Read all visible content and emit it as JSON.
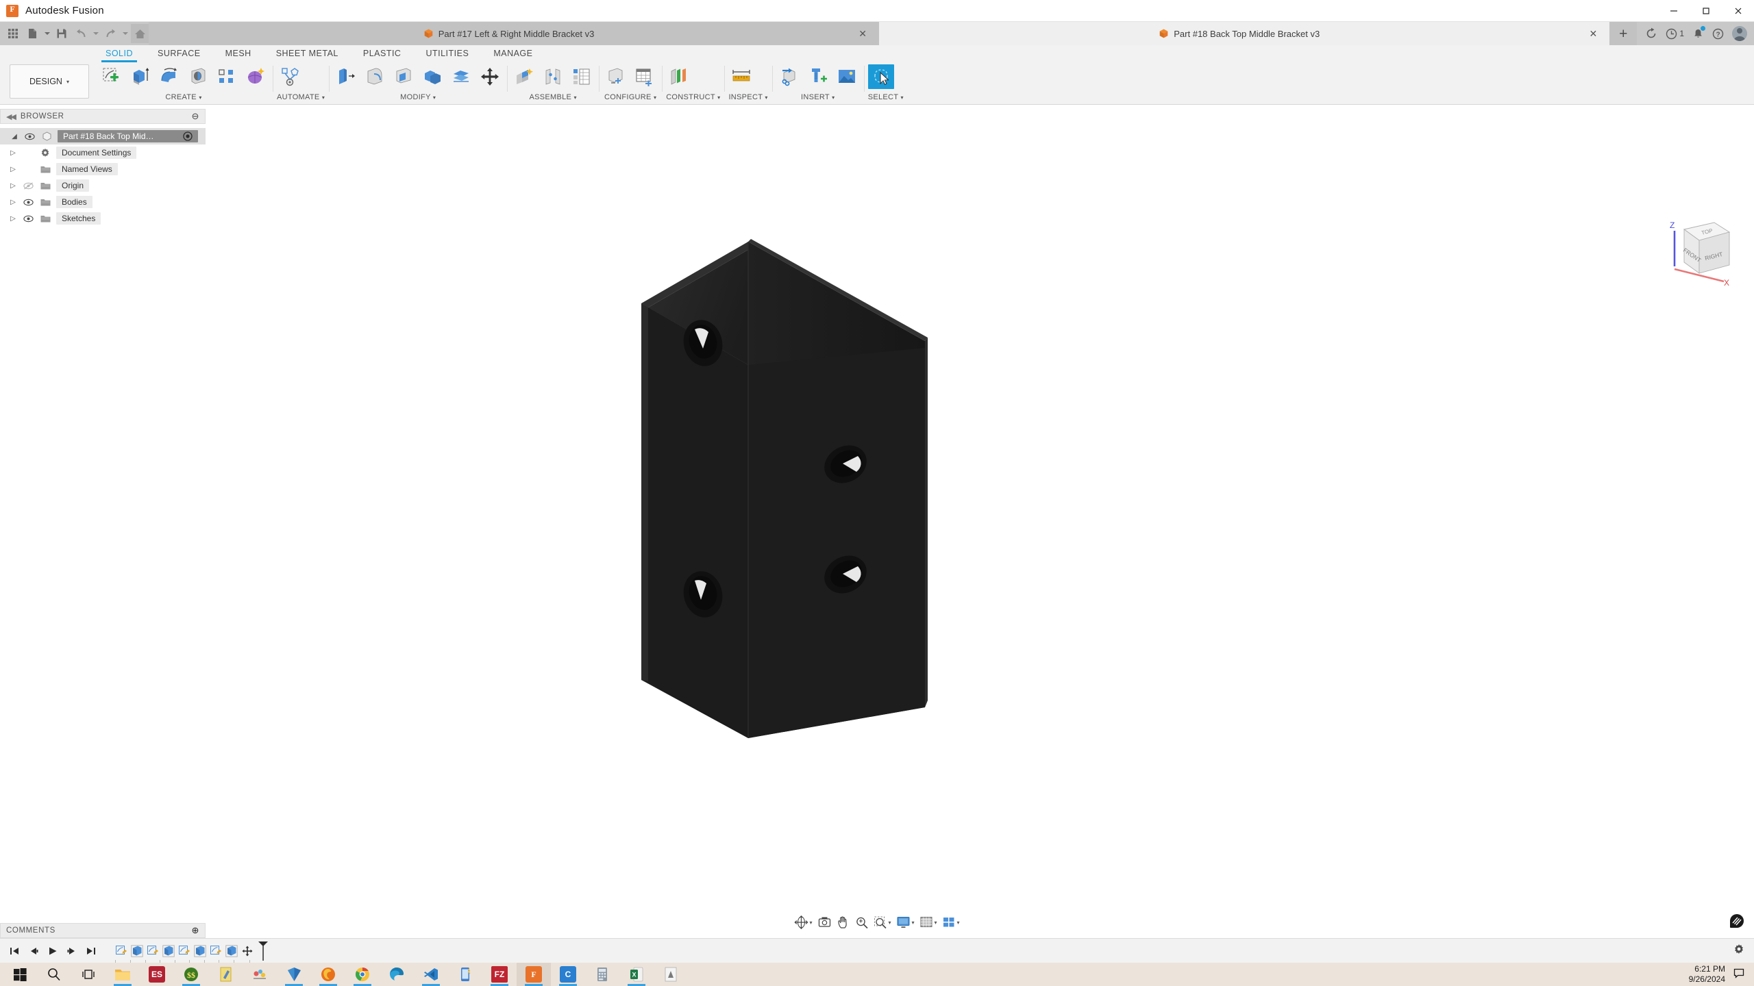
{
  "window": {
    "title": "Autodesk Fusion",
    "logo_icon": "fusion-logo-icon",
    "minimize_label": "—",
    "maximize_label": "□",
    "close_label": "✕"
  },
  "quick_access": {
    "items": [
      {
        "name": "app-grid-icon",
        "label": "App Grid"
      },
      {
        "name": "new-file-icon",
        "label": "New"
      },
      {
        "name": "save-icon",
        "label": "Save"
      },
      {
        "name": "undo-icon",
        "label": "Undo"
      },
      {
        "name": "redo-icon",
        "label": "Redo"
      },
      {
        "name": "home-icon",
        "label": "Home"
      }
    ]
  },
  "document_tabs": [
    {
      "title": "Part #17 Left & Right Middle Bracket v3",
      "active": false,
      "close_label": "✕"
    },
    {
      "title": "Part #18 Back Top Middle Bracket v3",
      "active": true,
      "close_label": "✕"
    }
  ],
  "new_tab_label": "+",
  "account_bar": {
    "sync_icon": "refresh-icon",
    "jobs_icon": "job-status-clock-icon",
    "jobs_count": "1",
    "notifications_icon": "bell-icon",
    "help_icon": "help-icon",
    "avatar_icon": "user-avatar"
  },
  "ribbon": {
    "workspace": "DESIGN",
    "workspace_caret": "▾",
    "tabs": [
      {
        "label": "SOLID",
        "active": true
      },
      {
        "label": "SURFACE",
        "active": false
      },
      {
        "label": "MESH",
        "active": false
      },
      {
        "label": "SHEET METAL",
        "active": false
      },
      {
        "label": "PLASTIC",
        "active": false
      },
      {
        "label": "UTILITIES",
        "active": false
      },
      {
        "label": "MANAGE",
        "active": false
      }
    ],
    "panels": [
      {
        "label": "CREATE",
        "caret": "▾",
        "tools": [
          {
            "name": "create-sketch-icon",
            "label": "Create Sketch"
          },
          {
            "name": "extrude-icon",
            "label": "Extrude"
          },
          {
            "name": "revolve-icon",
            "label": "Revolve"
          },
          {
            "name": "hole-icon",
            "label": "Hole"
          },
          {
            "name": "pattern-icon",
            "label": "Rectangular Pattern"
          },
          {
            "name": "create-form-icon",
            "label": "Create Form"
          }
        ]
      },
      {
        "label": "AUTOMATE",
        "caret": "▾",
        "tools": [
          {
            "name": "automated-modeling-icon",
            "label": "Automated Modeling"
          }
        ]
      },
      {
        "label": "MODIFY",
        "caret": "▾",
        "tools": [
          {
            "name": "press-pull-icon",
            "label": "Press Pull"
          },
          {
            "name": "fillet-icon",
            "label": "Fillet"
          },
          {
            "name": "shell-icon",
            "label": "Shell"
          },
          {
            "name": "combine-icon",
            "label": "Combine"
          },
          {
            "name": "offset-face-icon",
            "label": "Offset Face"
          },
          {
            "name": "move-copy-icon",
            "label": "Move/Copy"
          }
        ]
      },
      {
        "label": "ASSEMBLE",
        "caret": "▾",
        "tools": [
          {
            "name": "new-component-icon",
            "label": "New Component"
          },
          {
            "name": "joint-icon",
            "label": "Joint"
          },
          {
            "name": "bom-icon",
            "label": "Bill of Materials"
          }
        ]
      },
      {
        "label": "CONFIGURE",
        "caret": "▾",
        "tools": [
          {
            "name": "configuration-icon",
            "label": "Create Configuration"
          },
          {
            "name": "configuration-table-icon",
            "label": "Configuration Table"
          }
        ]
      },
      {
        "label": "CONSTRUCT",
        "caret": "▾",
        "tools": [
          {
            "name": "offset-plane-icon",
            "label": "Offset Plane"
          }
        ]
      },
      {
        "label": "INSPECT",
        "caret": "▾",
        "tools": [
          {
            "name": "measure-icon",
            "label": "Measure"
          }
        ]
      },
      {
        "label": "INSERT",
        "caret": "▾",
        "tools": [
          {
            "name": "insert-derive-icon",
            "label": "Insert Derive"
          },
          {
            "name": "insert-mcmaster-icon",
            "label": "Insert McMaster-Carr Component"
          },
          {
            "name": "canvas-icon",
            "label": "Canvas"
          }
        ]
      },
      {
        "label": "SELECT",
        "caret": "▾",
        "tools": [
          {
            "name": "select-cursor-icon",
            "label": "Select"
          }
        ]
      }
    ]
  },
  "browser": {
    "header": "BROWSER",
    "collapse_icon": "collapse-left-icon",
    "minimize_label": "⊖",
    "tree": [
      {
        "label": "Part #18 Back Top Middle Bra...",
        "selected": true,
        "visible": true,
        "icon": "component-icon",
        "depth": 0
      },
      {
        "label": "Document Settings",
        "selected": false,
        "visible": null,
        "icon": "gear-icon",
        "depth": 1
      },
      {
        "label": "Named Views",
        "selected": false,
        "visible": null,
        "icon": "folder-icon",
        "depth": 1
      },
      {
        "label": "Origin",
        "selected": false,
        "visible": false,
        "icon": "folder-icon",
        "depth": 1
      },
      {
        "label": "Bodies",
        "selected": false,
        "visible": true,
        "icon": "folder-icon",
        "depth": 1
      },
      {
        "label": "Sketches",
        "selected": false,
        "visible": true,
        "icon": "folder-icon",
        "depth": 1
      }
    ]
  },
  "viewcube": {
    "top_face": "TOP",
    "front_face": "FRONT",
    "right_face": "RIGHT",
    "axis_z": "Z",
    "axis_x": "X",
    "z_color": "#4a4ad8",
    "x_color": "#e86464"
  },
  "viewport": {
    "background": "#ffffff",
    "model": {
      "name": "angle-bracket-body",
      "description": "L-shaped angle bracket, isometric view",
      "color": "#1b1b1b",
      "hole_count": 4
    },
    "badge_icon": "view-badge-icon"
  },
  "navbar": {
    "items": [
      {
        "name": "orbit-icon",
        "label": "Orbit",
        "caret": "▾"
      },
      {
        "name": "look-at-icon",
        "label": "Look At",
        "caret": ""
      },
      {
        "name": "pan-icon",
        "label": "Pan",
        "caret": ""
      },
      {
        "name": "zoom-icon",
        "label": "Zoom",
        "caret": ""
      },
      {
        "name": "fit-icon",
        "label": "Fit",
        "caret": "▾"
      },
      {
        "name": "display-settings-icon",
        "label": "Display Settings",
        "caret": "▾"
      },
      {
        "name": "grid-snaps-icon",
        "label": "Grid and Snaps",
        "caret": "▾"
      },
      {
        "name": "viewports-icon",
        "label": "Viewports",
        "caret": "▾"
      }
    ]
  },
  "comments": {
    "header": "COMMENTS",
    "add_label": "⊕"
  },
  "timeline": {
    "playback": [
      {
        "name": "go-to-beginning-icon",
        "label": "Go to Beginning"
      },
      {
        "name": "step-back-icon",
        "label": "Step Back"
      },
      {
        "name": "play-icon",
        "label": "Play"
      },
      {
        "name": "step-forward-icon",
        "label": "Step Forward"
      },
      {
        "name": "go-to-end-icon",
        "label": "Go to End"
      }
    ],
    "features": [
      {
        "name": "timeline-sketch-icon",
        "label": "Sketch1"
      },
      {
        "name": "timeline-extrude-icon",
        "label": "Extrude1"
      },
      {
        "name": "timeline-sketch-icon",
        "label": "Sketch2"
      },
      {
        "name": "timeline-extrude-icon",
        "label": "Extrude2"
      },
      {
        "name": "timeline-sketch-icon",
        "label": "Sketch3"
      },
      {
        "name": "timeline-extrude-icon",
        "label": "Extrude3"
      },
      {
        "name": "timeline-sketch-icon",
        "label": "Sketch4"
      },
      {
        "name": "timeline-extrude-icon",
        "label": "Extrude4"
      },
      {
        "name": "timeline-move-icon",
        "label": "Move"
      }
    ],
    "settings_icon": "timeline-settings-icon"
  },
  "taskbar": {
    "start_icon": "windows-start-icon",
    "search_icon": "search-icon",
    "taskview_icon": "task-view-icon",
    "apps": [
      {
        "name": "file-explorer-icon",
        "label": "File Explorer",
        "color": "#f0b33c",
        "text": "",
        "running": true,
        "active": false
      },
      {
        "name": "es-app-icon",
        "label": "ES",
        "color": "#b22233",
        "text": "ES",
        "running": false,
        "active": false
      },
      {
        "name": "s-app-icon",
        "label": "Sublime",
        "color": "#3a7a20",
        "text": "",
        "running": true,
        "active": false
      },
      {
        "name": "notepad-icon",
        "label": "Notepad",
        "color": "#e8c840",
        "text": "",
        "running": false,
        "active": false
      },
      {
        "name": "paint-icon",
        "label": "Paint",
        "color": "#cfcfcf",
        "text": "",
        "running": false,
        "active": false
      },
      {
        "name": "vault-icon",
        "label": "Vault",
        "color": "#2a6fb5",
        "text": "",
        "running": true,
        "active": false
      },
      {
        "name": "firefox-icon",
        "label": "Firefox",
        "color": "#e8711a",
        "text": "",
        "running": true,
        "active": false
      },
      {
        "name": "chrome-icon",
        "label": "Chrome",
        "color": "#d8453c",
        "text": "",
        "running": true,
        "active": false
      },
      {
        "name": "edge-icon",
        "label": "Edge",
        "color": "#2aa2d8",
        "text": "",
        "running": false,
        "active": false
      },
      {
        "name": "vscode-icon",
        "label": "Visual Studio Code",
        "color": "#2a7fc9",
        "text": "",
        "running": true,
        "active": false
      },
      {
        "name": "phone-link-icon",
        "label": "Phone Link",
        "color": "#3f7fd0",
        "text": "",
        "running": false,
        "active": false
      },
      {
        "name": "filezilla-icon",
        "label": "FileZilla",
        "color": "#bf2430",
        "text": "FZ",
        "running": true,
        "active": false
      },
      {
        "name": "fusion-icon",
        "label": "Autodesk Fusion",
        "color": "#e8722a",
        "text": "F",
        "running": true,
        "active": true
      },
      {
        "name": "c-app-icon",
        "label": "C App",
        "color": "#2a7fd0",
        "text": "C",
        "running": true,
        "active": false
      },
      {
        "name": "calculator-icon",
        "label": "Calculator",
        "color": "#5a6a7a",
        "text": "",
        "running": false,
        "active": false
      },
      {
        "name": "excel-icon",
        "label": "Excel",
        "color": "#1d7a46",
        "text": "",
        "running": true,
        "active": false
      },
      {
        "name": "bit-app-icon",
        "label": "App",
        "color": "#d8d8d8",
        "text": "",
        "running": false,
        "active": false
      }
    ],
    "clock_time": "6:21 PM",
    "clock_date": "9/26/2024",
    "tray_icon": "notification-center-icon"
  }
}
